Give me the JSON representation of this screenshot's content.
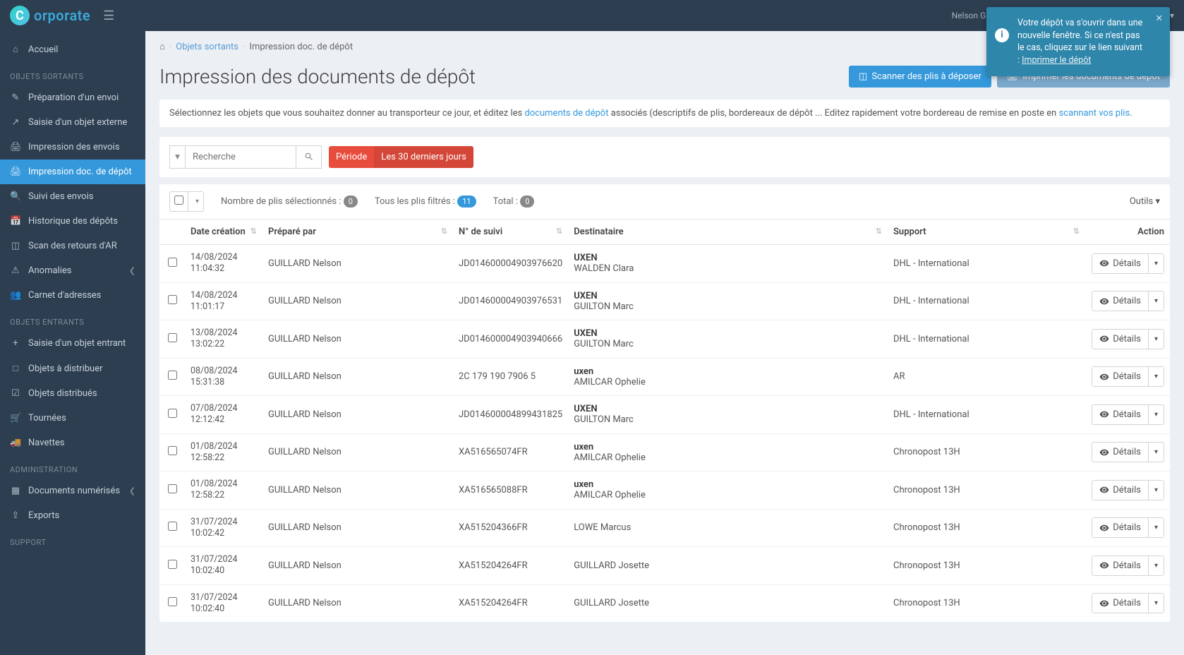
{
  "app": {
    "brand_initial": "C",
    "brand_rest": "orporate"
  },
  "user": {
    "display": "Nelson GUILLARD - Corporate - site JUPITER (Corporate)"
  },
  "sidebar": {
    "home": "Accueil",
    "sec_sortants": "OBJETS SORTANTS",
    "sortants": [
      "Préparation d'un envoi",
      "Saisie d'un objet externe",
      "Impression des envois",
      "Impression doc. de dépôt",
      "Suivi des envois",
      "Historique des dépôts",
      "Scan des retours d'AR",
      "Anomalies",
      "Carnet d'adresses"
    ],
    "sec_entrants": "OBJETS ENTRANTS",
    "entrants": [
      "Saisie d'un objet entrant",
      "Objets à distribuer",
      "Objets distribués",
      "Tournées",
      "Navettes"
    ],
    "sec_admin": "ADMINISTRATION",
    "admin": [
      "Documents numérisés",
      "Exports"
    ],
    "sec_support": "SUPPORT"
  },
  "breadcrumb": {
    "l1": "Objets sortants",
    "l2": "Impression doc. de dépôt"
  },
  "page": {
    "title": "Impression des documents de dépôt",
    "btn_scan": "Scanner des plis à déposer",
    "btn_print": "Imprimer les documents de dépôt"
  },
  "info": {
    "pre": "Sélectionnez les objets que vous souhaitez donner au transporteur ce jour, et éditez les ",
    "link1": "documents de dépôt",
    "mid": " associés (descriptifs de plis, bordereaux de dépôt ... Editez rapidement votre bordereau de remise en poste en ",
    "link2": "scannant vos plis",
    "post": "."
  },
  "search": {
    "placeholder": "Recherche"
  },
  "period": {
    "label": "Période",
    "value": "Les 30 derniers jours"
  },
  "stats": {
    "selected_label": "Nombre de plis sélectionnés :",
    "selected": "0",
    "filtered_label": "Tous les plis filtrés :",
    "filtered": "11",
    "total_label": "Total :",
    "total": "0",
    "tools": "Outils"
  },
  "columns": {
    "date": "Date création",
    "preparer": "Préparé par",
    "suivi": "N° de suivi",
    "dest": "Destinataire",
    "support": "Support",
    "action": "Action"
  },
  "details_label": "Détails",
  "rows": [
    {
      "date": "14/08/2024 11:04:32",
      "prep": "GUILLARD Nelson",
      "suivi": "JD014600004903976620",
      "dest_org": "UXEN",
      "dest_name": "WALDEN Clara",
      "support": "DHL - International"
    },
    {
      "date": "14/08/2024 11:01:17",
      "prep": "GUILLARD Nelson",
      "suivi": "JD014600004903976531",
      "dest_org": "UXEN",
      "dest_name": "GUILTON Marc",
      "support": "DHL - International"
    },
    {
      "date": "13/08/2024 13:02:22",
      "prep": "GUILLARD Nelson",
      "suivi": "JD014600004903940666",
      "dest_org": "UXEN",
      "dest_name": "GUILTON Marc",
      "support": "DHL - International"
    },
    {
      "date": "08/08/2024 15:31:38",
      "prep": "GUILLARD Nelson",
      "suivi": "2C 179 190 7906 5",
      "dest_org": "uxen",
      "dest_name": "AMILCAR Ophelie",
      "support": "AR"
    },
    {
      "date": "07/08/2024 12:12:42",
      "prep": "GUILLARD Nelson",
      "suivi": "JD014600004899431825",
      "dest_org": "UXEN",
      "dest_name": "GUILTON Marc",
      "support": "DHL - International"
    },
    {
      "date": "01/08/2024 12:58:22",
      "prep": "GUILLARD Nelson",
      "suivi": "XA516565074FR",
      "dest_org": "uxen",
      "dest_name": "AMILCAR Ophelie",
      "support": "Chronopost 13H"
    },
    {
      "date": "01/08/2024 12:58:22",
      "prep": "GUILLARD Nelson",
      "suivi": "XA516565088FR",
      "dest_org": "uxen",
      "dest_name": "AMILCAR Ophelie",
      "support": "Chronopost 13H"
    },
    {
      "date": "31/07/2024 10:02:42",
      "prep": "GUILLARD Nelson",
      "suivi": "XA515204366FR",
      "dest_org": "",
      "dest_name": "LOWE Marcus",
      "support": "Chronopost 13H"
    },
    {
      "date": "31/07/2024 10:02:40",
      "prep": "GUILLARD Nelson",
      "suivi": "XA515204264FR",
      "dest_org": "",
      "dest_name": "GUILLARD Josette",
      "support": "Chronopost 13H"
    },
    {
      "date": "31/07/2024 10:02:40",
      "prep": "GUILLARD Nelson",
      "suivi": "XA515204264FR",
      "dest_org": "",
      "dest_name": "GUILLARD Josette",
      "support": "Chronopost 13H"
    }
  ],
  "toast": {
    "msg": "Votre dépôt va s'ouvrir dans une nouvelle fenêtre. Si ce n'est pas le cas, cliquez sur le lien suivant : ",
    "link": "Imprimer le dépôt"
  }
}
